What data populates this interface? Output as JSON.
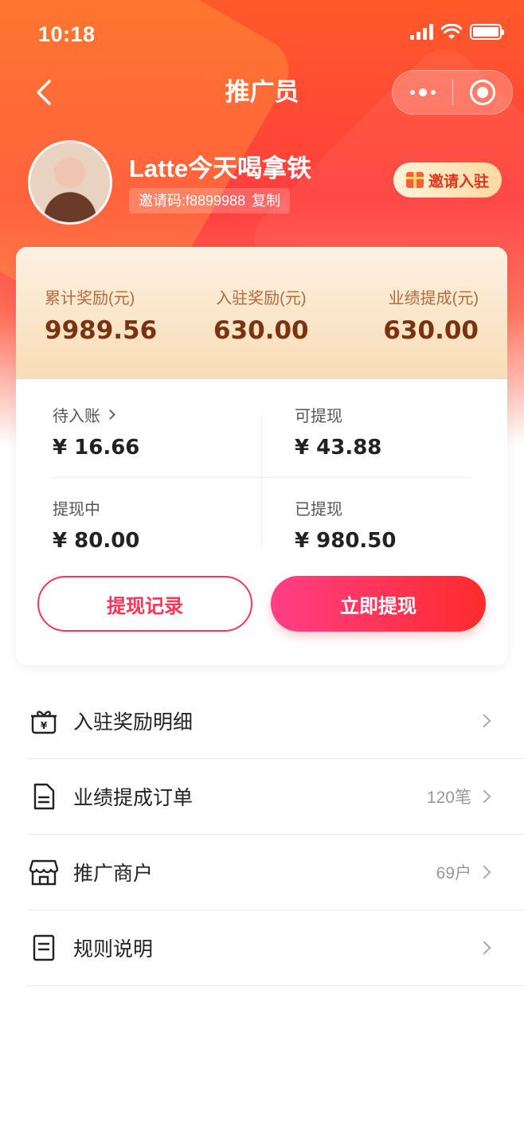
{
  "status_bar": {
    "time": "10:18"
  },
  "nav": {
    "title": "推广员"
  },
  "profile": {
    "name": "Latte今天喝拿铁",
    "invite_code": "邀请码:f8899988",
    "copy_label": "复制",
    "invite_button": "邀请入驻"
  },
  "summary": {
    "stats": [
      {
        "label": "累计奖励(元)",
        "value": "9989.56"
      },
      {
        "label": "入驻奖励(元)",
        "value": "630.00"
      },
      {
        "label": "业绩提成(元)",
        "value": "630.00"
      }
    ]
  },
  "balances": {
    "pending": {
      "label": "待入账",
      "value": "¥ 16.66"
    },
    "withdrawable": {
      "label": "可提现",
      "value": "¥ 43.88"
    },
    "withdrawing": {
      "label": "提现中",
      "value": "¥ 80.00"
    },
    "withdrawn": {
      "label": "已提现",
      "value": "¥ 980.50"
    }
  },
  "actions": {
    "history": "提现记录",
    "withdraw_now": "立即提现"
  },
  "menu": [
    {
      "label": "入驻奖励明细",
      "icon": "gift-icon",
      "meta": ""
    },
    {
      "label": "业绩提成订单",
      "icon": "document-icon",
      "meta": "120笔"
    },
    {
      "label": "推广商户",
      "icon": "store-icon",
      "meta": "69户"
    },
    {
      "label": "规则说明",
      "icon": "rules-icon",
      "meta": ""
    }
  ],
  "colors": {
    "primary": "#ff2b2b",
    "accent": "#ff3e86",
    "gold": "#7a3210"
  }
}
